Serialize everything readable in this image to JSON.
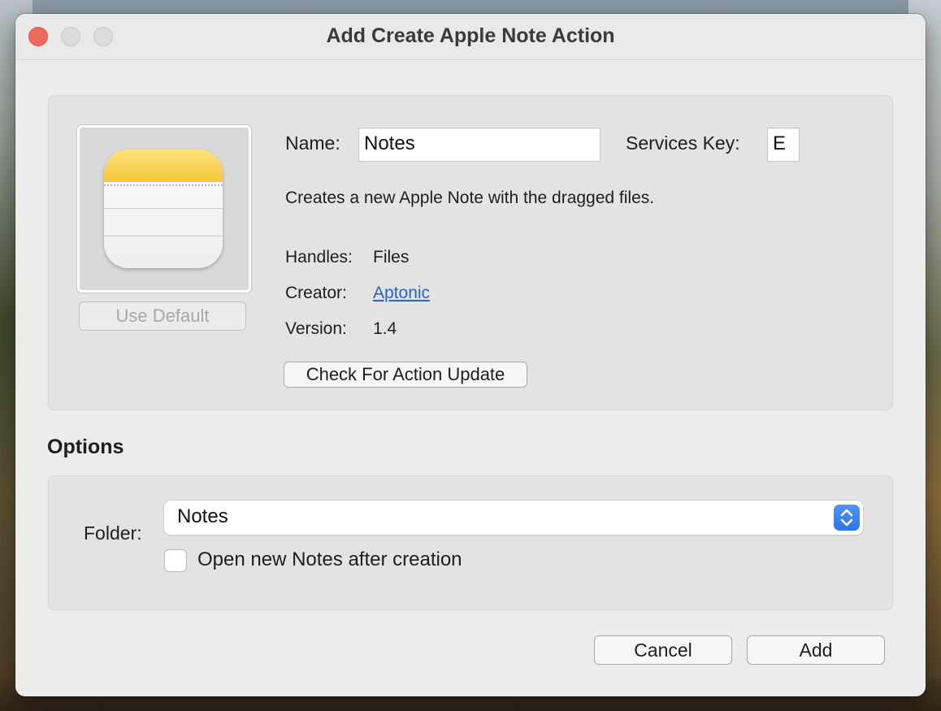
{
  "window": {
    "title": "Add Create Apple Note Action"
  },
  "action": {
    "name_label": "Name:",
    "name_value": "Notes",
    "services_key_label": "Services Key:",
    "services_key_value": "E",
    "description": "Creates a new Apple Note with the dragged files.",
    "handles_label": "Handles:",
    "handles_value": "Files",
    "creator_label": "Creator:",
    "creator_value": "Aptonic",
    "version_label": "Version:",
    "version_value": "1.4",
    "use_default_label": "Use Default",
    "check_update_label": "Check For Action Update",
    "icon": "apple-notes-icon"
  },
  "options": {
    "heading": "Options",
    "folder_label": "Folder:",
    "folder_value": "Notes",
    "open_after_label": "Open new Notes after creation",
    "open_after_checked": false
  },
  "footer": {
    "cancel_label": "Cancel",
    "add_label": "Add"
  },
  "colors": {
    "close_button": "#ed6a5e",
    "link": "#2a63c8",
    "accent": "#2f74e8"
  }
}
